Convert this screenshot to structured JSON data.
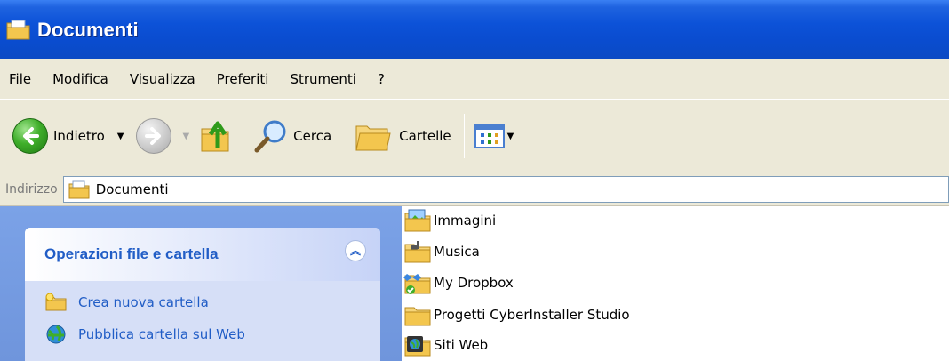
{
  "window": {
    "title": "Documenti"
  },
  "menu": {
    "items": [
      "File",
      "Modifica",
      "Visualizza",
      "Preferiti",
      "Strumenti",
      "?"
    ]
  },
  "toolbar": {
    "back_label": "Indietro",
    "search_label": "Cerca",
    "folders_label": "Cartelle"
  },
  "address": {
    "label": "Indirizzo",
    "value": "Documenti"
  },
  "taskpane": {
    "panel_title": "Operazioni file e cartella",
    "links": [
      {
        "label": "Crea nuova cartella",
        "icon": "new-folder-icon"
      },
      {
        "label": "Pubblica cartella sul Web",
        "icon": "publish-web-icon"
      }
    ]
  },
  "files": [
    {
      "name": "Immagini",
      "icon": "pictures-folder-icon"
    },
    {
      "name": "Musica",
      "icon": "music-folder-icon"
    },
    {
      "name": "My Dropbox",
      "icon": "dropbox-folder-icon"
    },
    {
      "name": "Progetti CyberInstaller Studio",
      "icon": "folder-icon"
    },
    {
      "name": "Siti Web",
      "icon": "websites-folder-icon"
    }
  ],
  "colors": {
    "title_bar": "#0a4ccf",
    "chrome": "#ece9d8",
    "taskpane_bg": "#7ba2e7",
    "link": "#215dc6"
  }
}
